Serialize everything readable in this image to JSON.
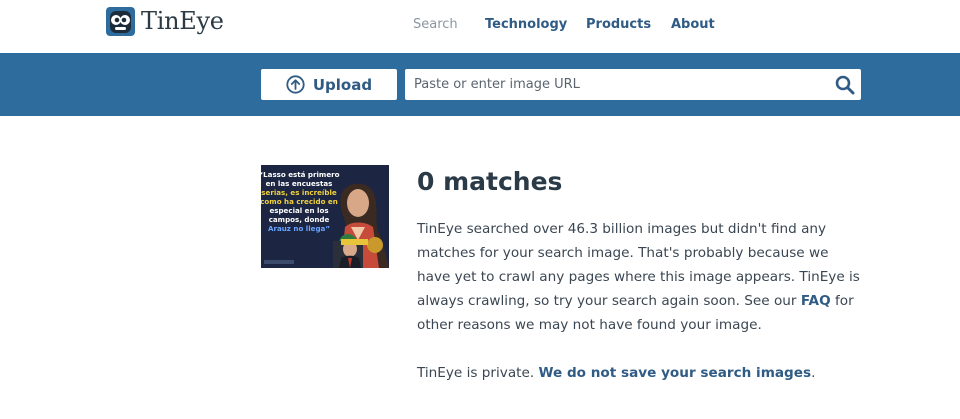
{
  "brand": {
    "name": "TinEye"
  },
  "nav": [
    {
      "label": "Search",
      "active": true
    },
    {
      "label": "Technology"
    },
    {
      "label": "Products"
    },
    {
      "label": "About"
    }
  ],
  "toolbar": {
    "upload_label": "Upload",
    "search_placeholder": "Paste or enter image URL"
  },
  "thumbnail": {
    "lines": [
      "“Lasso está primero",
      "en las encuestas",
      "serias, es increíble",
      "como ha crecido en",
      "especial en los",
      "campos, donde",
      "Arauz no llega”"
    ]
  },
  "results": {
    "title": "0 matches",
    "body_before_link": "TinEye searched over 46.3 billion images but didn't find any matches for your search image. That's probably because we have yet to crawl any pages where this image appears. TinEye is always crawling, so try your search again soon. See our ",
    "faq_link": "FAQ",
    "body_after_link": " for other reasons we may not have found your image.",
    "privacy_text": "TinEye is private. ",
    "privacy_link": "We do not save your search images",
    "privacy_end": "."
  },
  "colors": {
    "brand_blue": "#2f6c9e",
    "link": "#2f5b84"
  }
}
